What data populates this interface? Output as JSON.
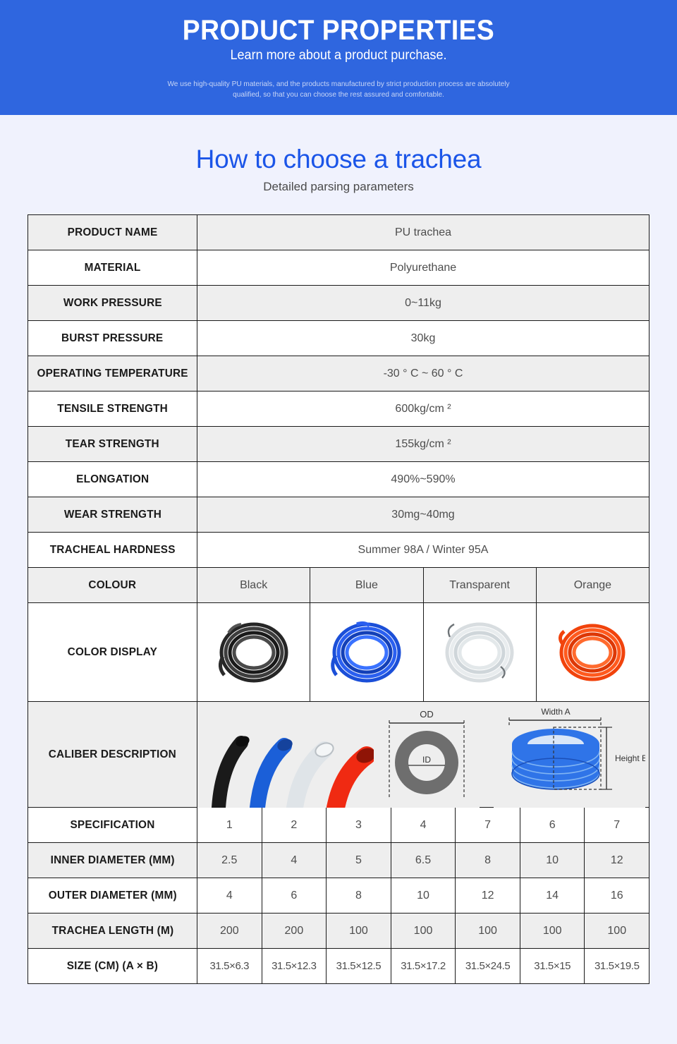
{
  "hero": {
    "title": "PRODUCT PROPERTIES",
    "subtitle": "Learn more about a product purchase.",
    "description": "We use high-quality PU materials, and the products manufactured by strict production process are absolutely qualified, so that you can choose the rest assured and comfortable.",
    "bg_color": "#2f66df"
  },
  "section": {
    "title": "How to choose a trachea",
    "subtitle": "Detailed parsing parameters",
    "title_color": "#1b55e8"
  },
  "properties": [
    {
      "label": "PRODUCT NAME",
      "value": "PU trachea"
    },
    {
      "label": "MATERIAL",
      "value": "Polyurethane"
    },
    {
      "label": "WORK PRESSURE",
      "value": "0~11kg"
    },
    {
      "label": "BURST PRESSURE",
      "value": "30kg"
    },
    {
      "label": "OPERATING TEMPERATURE",
      "value": "-30 ° C ~ 60 ° C"
    },
    {
      "label": "TENSILE STRENGTH",
      "value": "600kg/cm ²"
    },
    {
      "label": "TEAR STRENGTH",
      "value": "155kg/cm ²"
    },
    {
      "label": "ELONGATION",
      "value": "490%~590%"
    },
    {
      "label": "WEAR STRENGTH",
      "value": "30mg~40mg"
    },
    {
      "label": "TRACHEAL HARDNESS",
      "value": "Summer 98A / Winter 95A"
    }
  ],
  "colour": {
    "label": "COLOUR",
    "options": [
      "Black",
      "Blue",
      "Transparent",
      "Orange"
    ],
    "display_label": "COLOR DISPLAY",
    "swatches": [
      "#2b2b2b",
      "#1b4fd8",
      "#e4e8ea",
      "#f1430c"
    ]
  },
  "caliber": {
    "label": "CALIBER DESCRIPTION",
    "diagram": {
      "outer_label": "OD",
      "inner_label": "ID",
      "width_label": "Width A",
      "height_label": "Height B"
    },
    "tube_colors": [
      "#1a1a1a",
      "#1b5fd8",
      "#dfe4e8",
      "#f02a12"
    ]
  },
  "spec_table": {
    "rows": [
      {
        "label": "SPECIFICATION",
        "values": [
          "1",
          "2",
          "3",
          "4",
          "7",
          "6",
          "7"
        ]
      },
      {
        "label": "INNER DIAMETER (MM)",
        "values": [
          "2.5",
          "4",
          "5",
          "6.5",
          "8",
          "10",
          "12"
        ]
      },
      {
        "label": "OUTER DIAMETER (MM)",
        "values": [
          "4",
          "6",
          "8",
          "10",
          "12",
          "14",
          "16"
        ]
      },
      {
        "label": "TRACHEA LENGTH (M)",
        "values": [
          "200",
          "200",
          "100",
          "100",
          "100",
          "100",
          "100"
        ]
      },
      {
        "label": "SIZE (CM) (A × B)",
        "values": [
          "31.5×6.3",
          "31.5×12.3",
          "31.5×12.5",
          "31.5×17.2",
          "31.5×24.5",
          "31.5×15",
          "31.5×19.5"
        ]
      }
    ]
  }
}
